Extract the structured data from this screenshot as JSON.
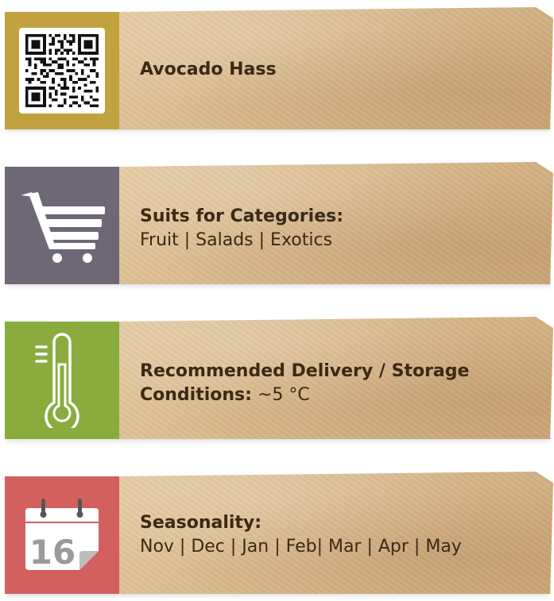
{
  "product": {
    "name": "Avocado Hass"
  },
  "categories": {
    "heading": "Suits for Categories:",
    "list": "Fruit | Salads | Exotics"
  },
  "storage": {
    "heading_line1": "Recommended Delivery / Storage",
    "heading_line2": "Conditions:",
    "value": "~5 °C"
  },
  "seasonality": {
    "heading": "Seasonality:",
    "months": "Nov | Dec | Jan | Feb| Mar | Apr | May",
    "calendar_day": "16"
  },
  "colors": {
    "product_block": "#c2a23e",
    "categories_block": "#6d6776",
    "storage_block": "#8aac3e",
    "season_block": "#d45f5f",
    "paper": "#d9b98c"
  },
  "icons": {
    "product": "qr-code-icon",
    "categories": "shopping-cart-icon",
    "storage": "thermometer-icon",
    "seasonality": "calendar-icon"
  }
}
